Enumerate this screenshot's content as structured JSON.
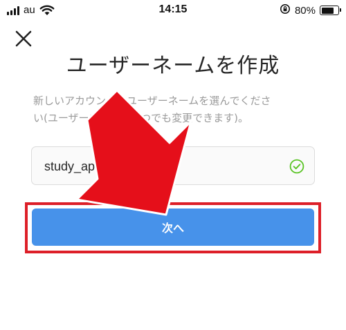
{
  "status_bar": {
    "carrier": "au",
    "time": "14:15",
    "battery_percent": "80%",
    "battery_level": 0.8,
    "icons": [
      "signal-icon",
      "wifi-icon",
      "rotation-lock-icon",
      "battery-icon"
    ]
  },
  "header": {
    "close_icon": "close-icon",
    "title": "ユーザーネームを作成"
  },
  "description": {
    "line1": "新しいアカウントのユーザーネームを選んでくださ",
    "line2": "い(ユーザーネームはいつでも変更できます)。"
  },
  "username_field": {
    "value": "study_appli_",
    "status_icon": "check-circle-icon"
  },
  "next_button": {
    "label": "次へ"
  },
  "annotation": {
    "arrow_color": "#e50f1a",
    "highlight_color": "#dd1f28"
  },
  "colors": {
    "button": "#4792ea",
    "check": "#58c322"
  }
}
